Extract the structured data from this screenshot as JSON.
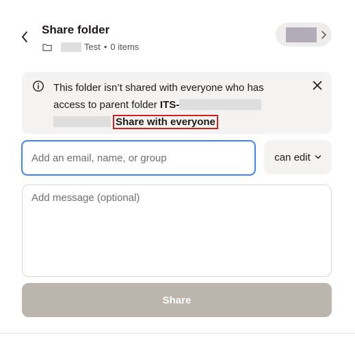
{
  "header": {
    "title": "Share folder",
    "folder_name": "Test",
    "dot": "•",
    "item_count": "0 items"
  },
  "banner": {
    "text_before": "This folder isn’t shared with everyone who has access to parent folder ",
    "parent_folder_prefix": "ITS-",
    "action_label": "Share with everyone"
  },
  "invite": {
    "email_placeholder": "Add an email, name, or group",
    "permission_value": "can edit",
    "message_placeholder": "Add message (optional)"
  },
  "actions": {
    "share_label": "Share"
  },
  "icons": {
    "back": "chevron-left-icon",
    "folder": "folder-icon",
    "owner_chevron": "chevron-right-icon",
    "info": "info-icon",
    "close": "close-icon",
    "dropdown": "chevron-down-icon"
  },
  "colors": {
    "focus_border": "#3984ff",
    "highlight_box": "#d21f1f",
    "share_button_disabled": "#bbb5ae",
    "banner_bg": "#f5f3f1"
  }
}
